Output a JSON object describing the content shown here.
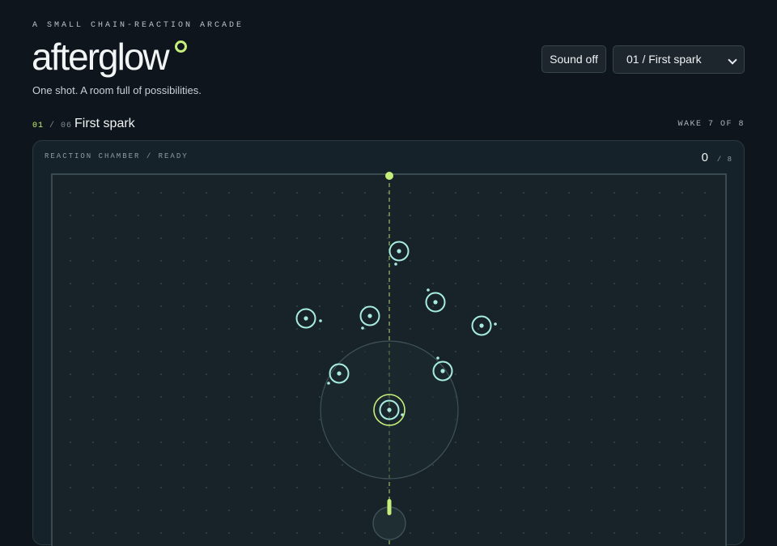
{
  "header": {
    "kicker": "A SMALL CHAIN-REACTION ARCADE",
    "logo": "afterglow",
    "tagline": "One shot. A room full of possibilities."
  },
  "controls": {
    "sound_label": "Sound off",
    "level_select": {
      "selected": "01 / First spark"
    }
  },
  "level": {
    "index": "01",
    "total": "06",
    "name": "First spark",
    "wake_status": "WAKE 7 OF 8"
  },
  "chamber": {
    "label": "REACTION CHAMBER / READY",
    "score": "0",
    "score_total": "/ 8"
  },
  "game": {
    "accent_color": "#c5ef7a",
    "orb_color": "#a8ece0",
    "orb_count": 8,
    "lit_count": 0
  }
}
